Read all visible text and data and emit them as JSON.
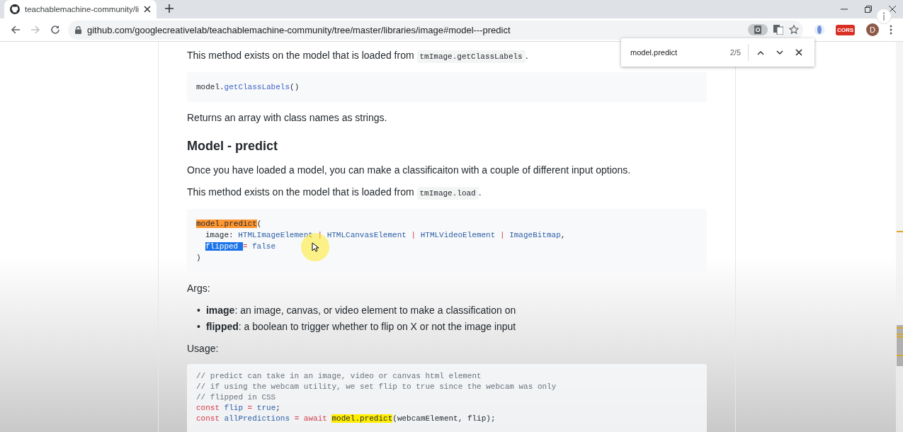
{
  "browser": {
    "tab": {
      "title": "teachablemachine-community/li",
      "selected": true
    },
    "address": "github.com/googlecreativelab/teachablemachine-community/tree/master/libraries/image#model---predict",
    "extension_label": "CORS",
    "profile_initial": "D"
  },
  "find_bar": {
    "query": "model.predict",
    "count": "2/5"
  },
  "document": [
    {
      "kind": "paragraph",
      "parts": [
        {
          "text": "This method exists on the model that is loaded from "
        },
        {
          "text": "tmImage.getClassLabels",
          "code": true
        },
        {
          "text": "."
        }
      ]
    },
    {
      "kind": "code",
      "lines": [
        {
          "tokens": [
            {
              "text": "model."
            },
            {
              "text": "getClassLabels",
              "kind": "fn"
            },
            {
              "text": "()"
            }
          ]
        }
      ]
    },
    {
      "kind": "paragraph",
      "parts": [
        {
          "text": "Returns an array with class names as strings."
        }
      ]
    },
    {
      "kind": "heading",
      "text": "Model - predict"
    },
    {
      "kind": "paragraph",
      "parts": [
        {
          "text": "Once you have loaded a model, you can make a classificaiton with a couple of different input options."
        }
      ]
    },
    {
      "kind": "paragraph",
      "parts": [
        {
          "text": "This method exists on the model that is loaded from "
        },
        {
          "text": "tmImage.load",
          "code": true
        },
        {
          "text": "."
        }
      ]
    },
    {
      "kind": "code",
      "lines": [
        {
          "tokens": [
            {
              "text": "model.predict",
              "kind": "current"
            },
            {
              "text": "("
            }
          ]
        },
        {
          "indent": true,
          "tokens": [
            {
              "text": "image: "
            },
            {
              "text": "HTMLImageElement",
              "kind": "type"
            },
            {
              "text": " | ",
              "kind": "op"
            },
            {
              "text": "HTMLCanvasElement",
              "kind": "type"
            },
            {
              "text": " | ",
              "kind": "op"
            },
            {
              "text": "HTMLVideoElement",
              "kind": "type"
            },
            {
              "text": " | ",
              "kind": "op"
            },
            {
              "text": "ImageBitmap",
              "kind": "type"
            },
            {
              "text": ","
            }
          ]
        },
        {
          "indent": true,
          "tokens": [
            {
              "text": "flipped ",
              "kind": "selected"
            },
            {
              "text": "= ",
              "kind": "op"
            },
            {
              "text": "false",
              "kind": "type"
            }
          ]
        },
        {
          "tokens": [
            {
              "text": ")"
            }
          ]
        }
      ]
    },
    {
      "kind": "paragraph",
      "parts": [
        {
          "text": "Args:"
        }
      ]
    },
    {
      "kind": "bullets",
      "items": [
        {
          "marker": "•",
          "term": "image",
          "text": ": an image, canvas, or video element to make a classification on"
        },
        {
          "marker": "•",
          "term": "flipped",
          "text": ": a boolean to trigger whether to flip on X or not the image input"
        }
      ]
    },
    {
      "kind": "paragraph",
      "parts": [
        {
          "text": "Usage:"
        }
      ]
    },
    {
      "kind": "code",
      "lines": [
        {
          "tokens": [
            {
              "text": "// predict can take in an image, video or canvas html element",
              "kind": "comment"
            }
          ]
        },
        {
          "tokens": [
            {
              "text": "// if using the webcam utility, we set flip to true since the webcam was only",
              "kind": "comment"
            }
          ]
        },
        {
          "tokens": [
            {
              "text": "// flipped in CSS",
              "kind": "comment"
            }
          ]
        },
        {
          "tokens": [
            {
              "text": "const ",
              "kind": "keyword"
            },
            {
              "text": "flip",
              "kind": "type"
            },
            {
              "text": " = ",
              "kind": "op"
            },
            {
              "text": "true",
              "kind": "type"
            },
            {
              "text": ";"
            }
          ]
        },
        {
          "tokens": [
            {
              "text": "const ",
              "kind": "keyword"
            },
            {
              "text": "allPredictions",
              "kind": "type"
            },
            {
              "text": " = ",
              "kind": "op"
            },
            {
              "text": "await ",
              "kind": "keyword"
            },
            {
              "text": "model.predict",
              "kind": "match"
            },
            {
              "text": "(webcamElement, flip);"
            }
          ]
        }
      ]
    }
  ]
}
